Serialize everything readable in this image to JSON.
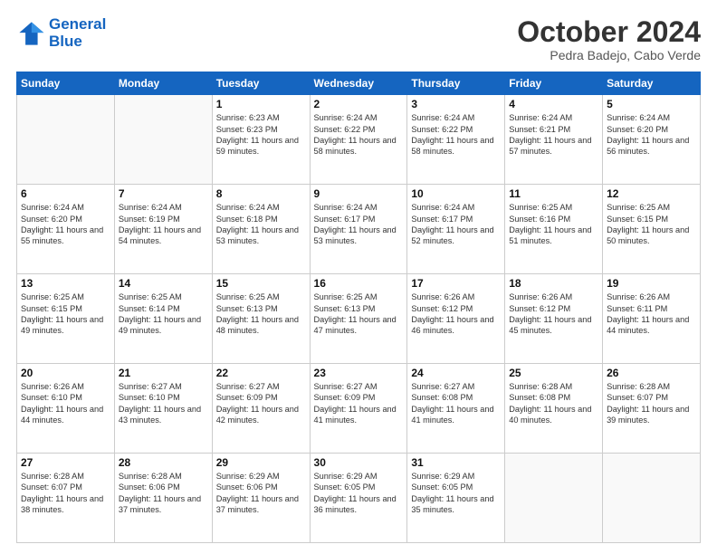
{
  "logo": {
    "line1": "General",
    "line2": "Blue"
  },
  "title": "October 2024",
  "subtitle": "Pedra Badejo, Cabo Verde",
  "days_header": [
    "Sunday",
    "Monday",
    "Tuesday",
    "Wednesday",
    "Thursday",
    "Friday",
    "Saturday"
  ],
  "weeks": [
    [
      {
        "day": "",
        "sunrise": "",
        "sunset": "",
        "daylight": ""
      },
      {
        "day": "",
        "sunrise": "",
        "sunset": "",
        "daylight": ""
      },
      {
        "day": "1",
        "sunrise": "Sunrise: 6:23 AM",
        "sunset": "Sunset: 6:23 PM",
        "daylight": "Daylight: 11 hours and 59 minutes."
      },
      {
        "day": "2",
        "sunrise": "Sunrise: 6:24 AM",
        "sunset": "Sunset: 6:22 PM",
        "daylight": "Daylight: 11 hours and 58 minutes."
      },
      {
        "day": "3",
        "sunrise": "Sunrise: 6:24 AM",
        "sunset": "Sunset: 6:22 PM",
        "daylight": "Daylight: 11 hours and 58 minutes."
      },
      {
        "day": "4",
        "sunrise": "Sunrise: 6:24 AM",
        "sunset": "Sunset: 6:21 PM",
        "daylight": "Daylight: 11 hours and 57 minutes."
      },
      {
        "day": "5",
        "sunrise": "Sunrise: 6:24 AM",
        "sunset": "Sunset: 6:20 PM",
        "daylight": "Daylight: 11 hours and 56 minutes."
      }
    ],
    [
      {
        "day": "6",
        "sunrise": "Sunrise: 6:24 AM",
        "sunset": "Sunset: 6:20 PM",
        "daylight": "Daylight: 11 hours and 55 minutes."
      },
      {
        "day": "7",
        "sunrise": "Sunrise: 6:24 AM",
        "sunset": "Sunset: 6:19 PM",
        "daylight": "Daylight: 11 hours and 54 minutes."
      },
      {
        "day": "8",
        "sunrise": "Sunrise: 6:24 AM",
        "sunset": "Sunset: 6:18 PM",
        "daylight": "Daylight: 11 hours and 53 minutes."
      },
      {
        "day": "9",
        "sunrise": "Sunrise: 6:24 AM",
        "sunset": "Sunset: 6:17 PM",
        "daylight": "Daylight: 11 hours and 53 minutes."
      },
      {
        "day": "10",
        "sunrise": "Sunrise: 6:24 AM",
        "sunset": "Sunset: 6:17 PM",
        "daylight": "Daylight: 11 hours and 52 minutes."
      },
      {
        "day": "11",
        "sunrise": "Sunrise: 6:25 AM",
        "sunset": "Sunset: 6:16 PM",
        "daylight": "Daylight: 11 hours and 51 minutes."
      },
      {
        "day": "12",
        "sunrise": "Sunrise: 6:25 AM",
        "sunset": "Sunset: 6:15 PM",
        "daylight": "Daylight: 11 hours and 50 minutes."
      }
    ],
    [
      {
        "day": "13",
        "sunrise": "Sunrise: 6:25 AM",
        "sunset": "Sunset: 6:15 PM",
        "daylight": "Daylight: 11 hours and 49 minutes."
      },
      {
        "day": "14",
        "sunrise": "Sunrise: 6:25 AM",
        "sunset": "Sunset: 6:14 PM",
        "daylight": "Daylight: 11 hours and 49 minutes."
      },
      {
        "day": "15",
        "sunrise": "Sunrise: 6:25 AM",
        "sunset": "Sunset: 6:13 PM",
        "daylight": "Daylight: 11 hours and 48 minutes."
      },
      {
        "day": "16",
        "sunrise": "Sunrise: 6:25 AM",
        "sunset": "Sunset: 6:13 PM",
        "daylight": "Daylight: 11 hours and 47 minutes."
      },
      {
        "day": "17",
        "sunrise": "Sunrise: 6:26 AM",
        "sunset": "Sunset: 6:12 PM",
        "daylight": "Daylight: 11 hours and 46 minutes."
      },
      {
        "day": "18",
        "sunrise": "Sunrise: 6:26 AM",
        "sunset": "Sunset: 6:12 PM",
        "daylight": "Daylight: 11 hours and 45 minutes."
      },
      {
        "day": "19",
        "sunrise": "Sunrise: 6:26 AM",
        "sunset": "Sunset: 6:11 PM",
        "daylight": "Daylight: 11 hours and 44 minutes."
      }
    ],
    [
      {
        "day": "20",
        "sunrise": "Sunrise: 6:26 AM",
        "sunset": "Sunset: 6:10 PM",
        "daylight": "Daylight: 11 hours and 44 minutes."
      },
      {
        "day": "21",
        "sunrise": "Sunrise: 6:27 AM",
        "sunset": "Sunset: 6:10 PM",
        "daylight": "Daylight: 11 hours and 43 minutes."
      },
      {
        "day": "22",
        "sunrise": "Sunrise: 6:27 AM",
        "sunset": "Sunset: 6:09 PM",
        "daylight": "Daylight: 11 hours and 42 minutes."
      },
      {
        "day": "23",
        "sunrise": "Sunrise: 6:27 AM",
        "sunset": "Sunset: 6:09 PM",
        "daylight": "Daylight: 11 hours and 41 minutes."
      },
      {
        "day": "24",
        "sunrise": "Sunrise: 6:27 AM",
        "sunset": "Sunset: 6:08 PM",
        "daylight": "Daylight: 11 hours and 41 minutes."
      },
      {
        "day": "25",
        "sunrise": "Sunrise: 6:28 AM",
        "sunset": "Sunset: 6:08 PM",
        "daylight": "Daylight: 11 hours and 40 minutes."
      },
      {
        "day": "26",
        "sunrise": "Sunrise: 6:28 AM",
        "sunset": "Sunset: 6:07 PM",
        "daylight": "Daylight: 11 hours and 39 minutes."
      }
    ],
    [
      {
        "day": "27",
        "sunrise": "Sunrise: 6:28 AM",
        "sunset": "Sunset: 6:07 PM",
        "daylight": "Daylight: 11 hours and 38 minutes."
      },
      {
        "day": "28",
        "sunrise": "Sunrise: 6:28 AM",
        "sunset": "Sunset: 6:06 PM",
        "daylight": "Daylight: 11 hours and 37 minutes."
      },
      {
        "day": "29",
        "sunrise": "Sunrise: 6:29 AM",
        "sunset": "Sunset: 6:06 PM",
        "daylight": "Daylight: 11 hours and 37 minutes."
      },
      {
        "day": "30",
        "sunrise": "Sunrise: 6:29 AM",
        "sunset": "Sunset: 6:05 PM",
        "daylight": "Daylight: 11 hours and 36 minutes."
      },
      {
        "day": "31",
        "sunrise": "Sunrise: 6:29 AM",
        "sunset": "Sunset: 6:05 PM",
        "daylight": "Daylight: 11 hours and 35 minutes."
      },
      {
        "day": "",
        "sunrise": "",
        "sunset": "",
        "daylight": ""
      },
      {
        "day": "",
        "sunrise": "",
        "sunset": "",
        "daylight": ""
      }
    ]
  ]
}
